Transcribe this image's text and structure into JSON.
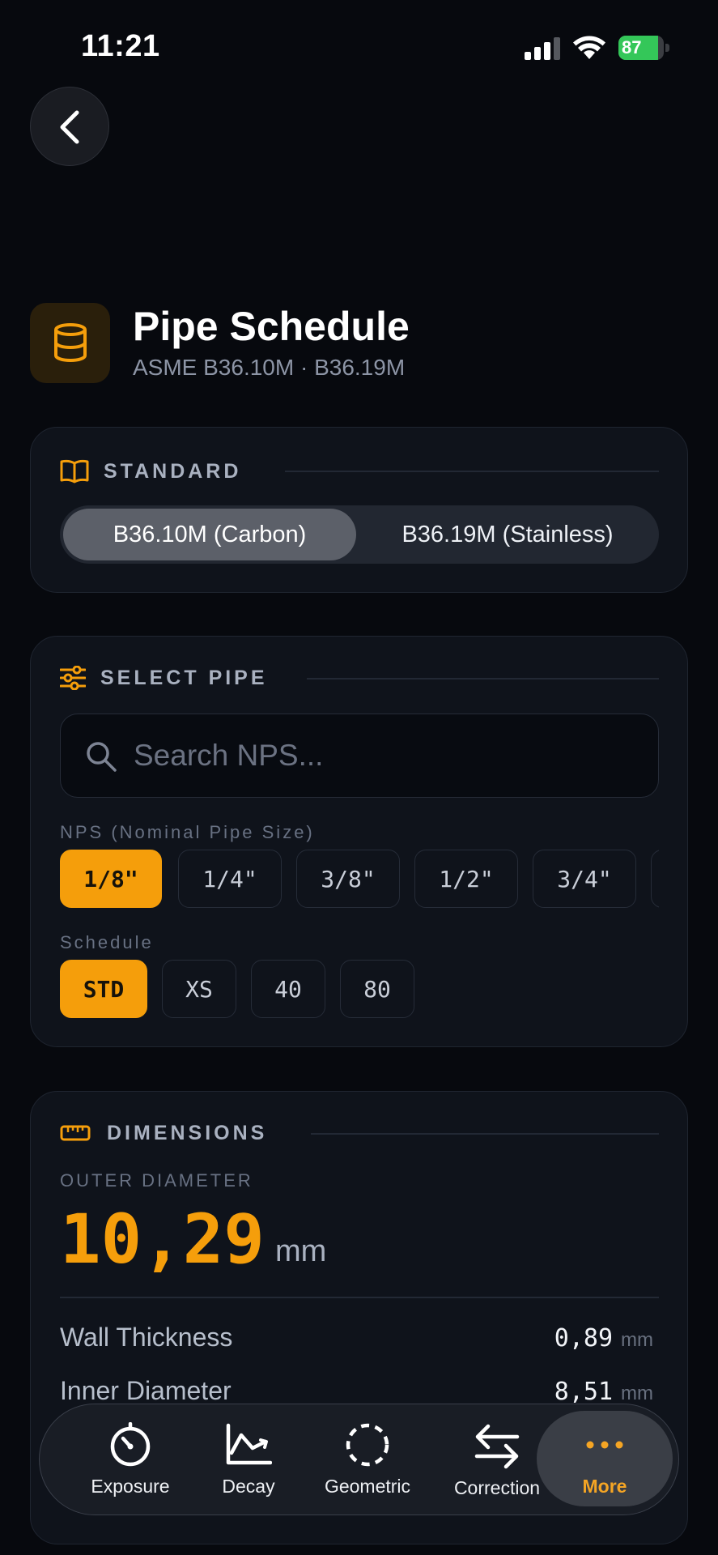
{
  "status_bar": {
    "time": "11:21",
    "battery": "87",
    "battery_level": 0.87
  },
  "header": {
    "title": "Pipe Schedule",
    "subtitle": "ASME B36.10M · B36.19M"
  },
  "standard": {
    "label": "STANDARD",
    "options": [
      {
        "label": "B36.10M (Carbon)",
        "selected": true
      },
      {
        "label": "B36.19M (Stainless)",
        "selected": false
      }
    ]
  },
  "select_pipe": {
    "label": "SELECT PIPE",
    "search_placeholder": "Search NPS...",
    "nps_label": "NPS (Nominal Pipe Size)",
    "nps_options": [
      "1/8\"",
      "1/4\"",
      "3/8\"",
      "1/2\"",
      "3/4\""
    ],
    "selected_nps": "1/8\"",
    "schedule_label": "Schedule",
    "schedule_options": [
      "STD",
      "XS",
      "40",
      "80"
    ],
    "selected_schedule": "STD"
  },
  "dimensions": {
    "label": "DIMENSIONS",
    "outer_diameter_label": "OUTER DIAMETER",
    "outer_diameter_value": "10,29",
    "outer_diameter_unit": "mm",
    "rows": [
      {
        "label": "Wall Thickness",
        "value": "0,89",
        "unit": "mm"
      },
      {
        "label": "Inner Diameter",
        "value": "8,51",
        "unit": "mm"
      }
    ]
  },
  "tab_bar": {
    "items": [
      {
        "label": "Exposure",
        "icon": "gauge-icon"
      },
      {
        "label": "Decay",
        "icon": "decay-chart-icon"
      },
      {
        "label": "Geometric",
        "icon": "dashed-circle-icon"
      },
      {
        "label": "Correction",
        "icon": "arrows-swap-icon"
      },
      {
        "label": "More",
        "icon": "more-dots-icon",
        "active": true
      }
    ],
    "active_color": "#f5a524"
  },
  "colors": {
    "accent": "#f59e0b",
    "background": "#07090e",
    "card": "#0f131b"
  }
}
